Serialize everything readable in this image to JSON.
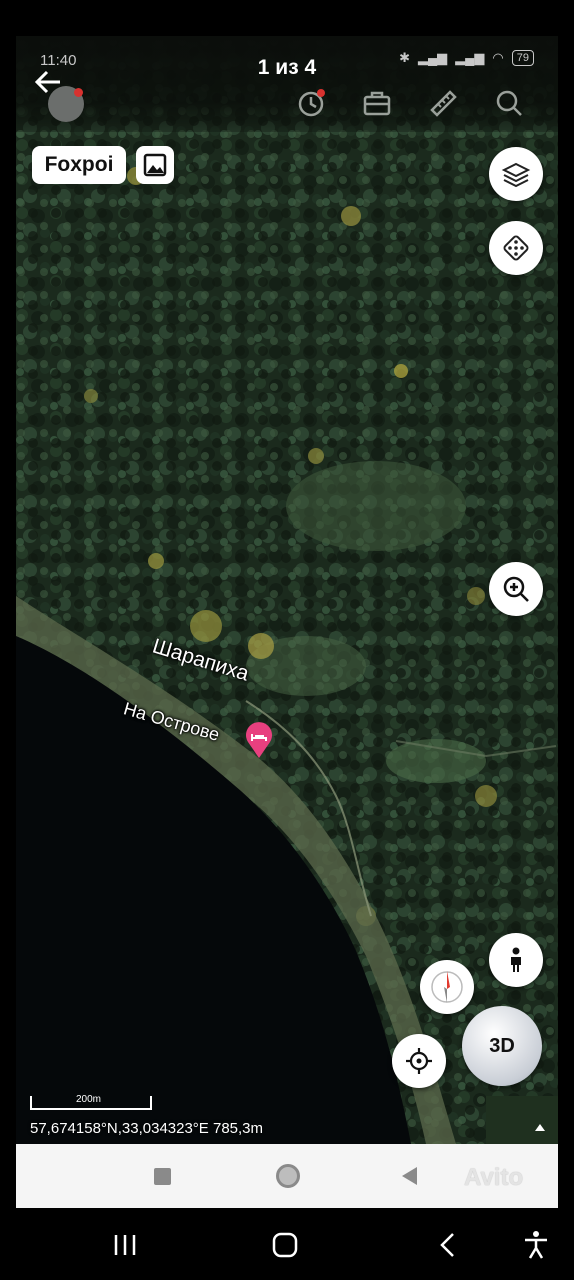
{
  "gallery": {
    "counter": "1 из 4"
  },
  "status": {
    "time": "11:40",
    "battery": "79"
  },
  "map": {
    "foxpoi_label": "Foxpoi",
    "place_label": "Шарапиха",
    "poi_label": "На Острове",
    "scale_label": "200m",
    "coords": "57,674158°N,33,034323°E   785,3m",
    "three_d_label": "3D",
    "watermark": "Avito"
  },
  "colors": {
    "accent": "#e8407f",
    "water": "#05080a",
    "forest": "#1a2a1c"
  }
}
